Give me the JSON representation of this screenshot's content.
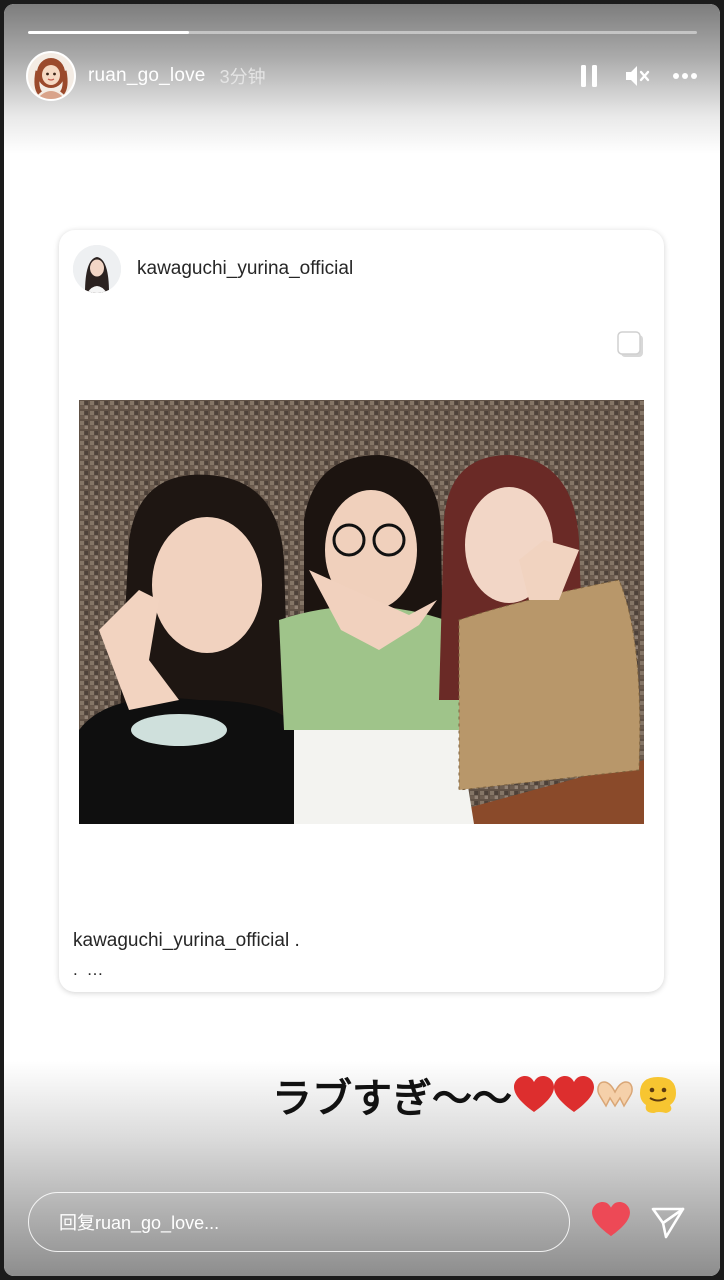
{
  "story": {
    "progress": 0.24,
    "username": "ruan_go_love",
    "time_ago": "3分钟"
  },
  "header_icons": [
    "pause-icon",
    "mute-icon",
    "more-icon"
  ],
  "post": {
    "username": "kawaguchi_yurina_official",
    "caption_user": "kawaguchi_yurina_official",
    "caption_suffix": ".",
    "caption_more": ". …",
    "photo_description_icon": "group-photo"
  },
  "overlay": {
    "text": "ラブすぎ〜〜",
    "emojis": [
      "red-heart",
      "red-heart",
      "heart-hands",
      "melting-face"
    ]
  },
  "reply": {
    "placeholder": "回复ruan_go_love..."
  },
  "colors": {
    "heart": "#ed4956",
    "text_dark": "#262626"
  }
}
